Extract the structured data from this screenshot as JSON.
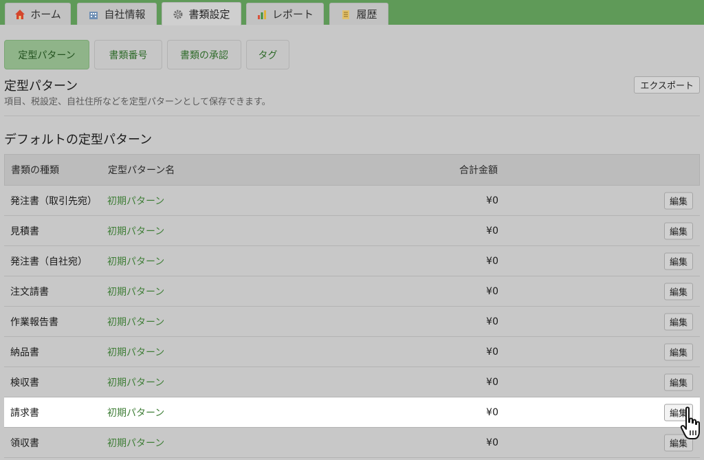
{
  "top_tabs": [
    {
      "label": "ホーム",
      "icon": "home-icon"
    },
    {
      "label": "自社情報",
      "icon": "company-icon"
    },
    {
      "label": "書類設定",
      "icon": "gear-icon"
    },
    {
      "label": "レポート",
      "icon": "chart-icon"
    },
    {
      "label": "履歴",
      "icon": "history-icon"
    }
  ],
  "sub_nav": [
    "定型パターン",
    "書類番号",
    "書類の承認",
    "タグ"
  ],
  "section": {
    "title": "定型パターン",
    "subtitle": "項目、税設定、自社住所などを定型パターンとして保存できます。",
    "export_label": "エクスポート"
  },
  "default_title": "デフォルトの定型パターン",
  "table": {
    "headers": [
      "書類の種類",
      "定型パターン名",
      "合計金額"
    ],
    "edit_label": "編集",
    "rows": [
      {
        "doc_type": "発注書（取引先宛）",
        "pattern": "初期パターン",
        "total": "¥0"
      },
      {
        "doc_type": "見積書",
        "pattern": "初期パターン",
        "total": "¥0"
      },
      {
        "doc_type": "発注書（自社宛）",
        "pattern": "初期パターン",
        "total": "¥0"
      },
      {
        "doc_type": "注文請書",
        "pattern": "初期パターン",
        "total": "¥0"
      },
      {
        "doc_type": "作業報告書",
        "pattern": "初期パターン",
        "total": "¥0"
      },
      {
        "doc_type": "納品書",
        "pattern": "初期パターン",
        "total": "¥0"
      },
      {
        "doc_type": "検収書",
        "pattern": "初期パターン",
        "total": "¥0"
      },
      {
        "doc_type": "請求書",
        "pattern": "初期パターン",
        "total": "¥0"
      },
      {
        "doc_type": "領収書",
        "pattern": "初期パターン",
        "total": "¥0"
      }
    ]
  },
  "colors": {
    "brand_green": "#5f9a58",
    "link_green": "#3f7e37",
    "overlay_gray": "#c8c8c8",
    "highlight": "#ffffff"
  }
}
